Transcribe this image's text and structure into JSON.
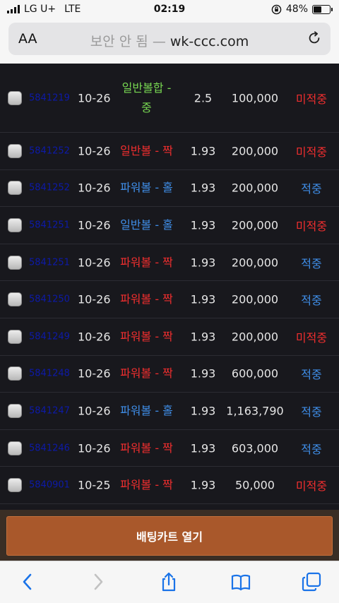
{
  "status_bar": {
    "carrier": "LG U+",
    "network": "LTE",
    "time": "02:19",
    "battery": "48%",
    "battery_level": 0.48
  },
  "address_bar": {
    "text_size_label": "AA",
    "security_text": "보안 안 됨",
    "separator": "—",
    "domain": "wk-ccc.com"
  },
  "bets": [
    {
      "id": "5841219",
      "date": "10-26",
      "game": "일반볼합 - 중",
      "game_color": "#78d852",
      "odds": "2.5",
      "amount": "100,000",
      "result": "미적중",
      "result_color": "#ef2e2e"
    },
    {
      "id": "5841252",
      "date": "10-26",
      "game": "일반볼 - 짝",
      "game_color": "#ef2e2e",
      "odds": "1.93",
      "amount": "200,000",
      "result": "미적중",
      "result_color": "#ef2e2e"
    },
    {
      "id": "5841252",
      "date": "10-26",
      "game": "파워볼 - 홀",
      "game_color": "#3f8ee8",
      "odds": "1.93",
      "amount": "200,000",
      "result": "적중",
      "result_color": "#3f8ee8"
    },
    {
      "id": "5841251",
      "date": "10-26",
      "game": "일반볼 - 홀",
      "game_color": "#3f8ee8",
      "odds": "1.93",
      "amount": "200,000",
      "result": "미적중",
      "result_color": "#ef2e2e"
    },
    {
      "id": "5841251",
      "date": "10-26",
      "game": "파워볼 - 짝",
      "game_color": "#ef2e2e",
      "odds": "1.93",
      "amount": "200,000",
      "result": "적중",
      "result_color": "#3f8ee8"
    },
    {
      "id": "5841250",
      "date": "10-26",
      "game": "파워볼 - 짝",
      "game_color": "#ef2e2e",
      "odds": "1.93",
      "amount": "200,000",
      "result": "적중",
      "result_color": "#3f8ee8"
    },
    {
      "id": "5841249",
      "date": "10-26",
      "game": "파워볼 - 짝",
      "game_color": "#ef2e2e",
      "odds": "1.93",
      "amount": "200,000",
      "result": "미적중",
      "result_color": "#ef2e2e"
    },
    {
      "id": "5841248",
      "date": "10-26",
      "game": "파워볼 - 짝",
      "game_color": "#ef2e2e",
      "odds": "1.93",
      "amount": "600,000",
      "result": "적중",
      "result_color": "#3f8ee8"
    },
    {
      "id": "5841247",
      "date": "10-26",
      "game": "파워볼 - 홀",
      "game_color": "#3f8ee8",
      "odds": "1.93",
      "amount": "1,163,790",
      "result": "적중",
      "result_color": "#3f8ee8"
    },
    {
      "id": "5841246",
      "date": "10-26",
      "game": "파워볼 - 짝",
      "game_color": "#ef2e2e",
      "odds": "1.93",
      "amount": "603,000",
      "result": "적중",
      "result_color": "#3f8ee8"
    },
    {
      "id": "5840901",
      "date": "10-25",
      "game": "파워볼 - 짝",
      "game_color": "#ef2e2e",
      "odds": "1.93",
      "amount": "50,000",
      "result": "미적중",
      "result_color": "#ef2e2e"
    }
  ],
  "cart_button_label": "배팅카트 열기",
  "toolbar": {
    "back": "chevron-left-icon",
    "forward": "chevron-right-icon",
    "share": "share-icon",
    "bookmarks": "book-icon",
    "tabs": "tabs-icon"
  }
}
